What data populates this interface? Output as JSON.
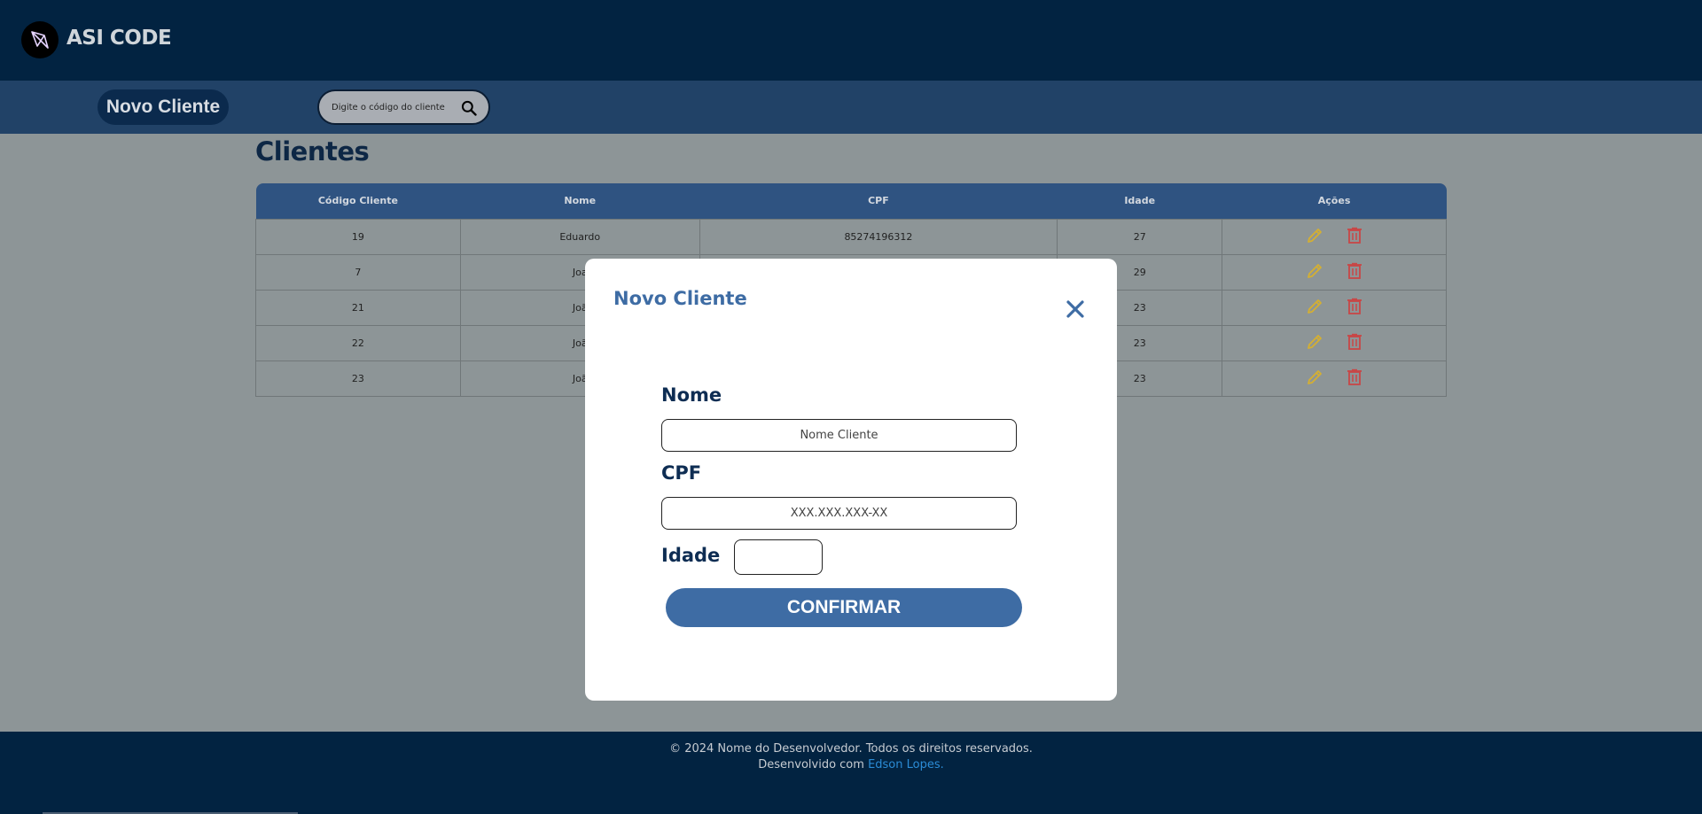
{
  "header": {
    "brand": "ASI CODE",
    "colors": {
      "background": "#022341",
      "nav": "#214267",
      "accent": "#3e6ca4"
    }
  },
  "nav": {
    "new_client_label": "Novo Cliente",
    "search_placeholder": "Digite o código do cliente"
  },
  "main": {
    "title": "Clientes",
    "table": {
      "columns": [
        "Código Cliente",
        "Nome",
        "CPF",
        "Idade",
        "Ações"
      ],
      "rows": [
        {
          "code": "19",
          "name": "Eduardo",
          "cpf": "85274196312",
          "age": "27"
        },
        {
          "code": "7",
          "name": "Joa",
          "cpf": "",
          "age": "29"
        },
        {
          "code": "21",
          "name": "Joã",
          "cpf": "",
          "age": "23"
        },
        {
          "code": "22",
          "name": "Joã",
          "cpf": "",
          "age": "23"
        },
        {
          "code": "23",
          "name": "Joã",
          "cpf": "",
          "age": "23"
        }
      ]
    }
  },
  "modal": {
    "title": "Novo Cliente",
    "name_label": "Nome",
    "name_placeholder": "Nome Cliente",
    "cpf_label": "CPF",
    "cpf_placeholder": "XXX.XXX.XXX-XX",
    "age_label": "Idade",
    "age_value": "",
    "confirm_label": "CONFIRMAR"
  },
  "footer": {
    "copyright": "© 2024 Nome do Desenvolvedor. Todos os direitos reservados.",
    "dev_prefix": "Desenvolvido com",
    "dev_link": "Edson Lopes."
  }
}
